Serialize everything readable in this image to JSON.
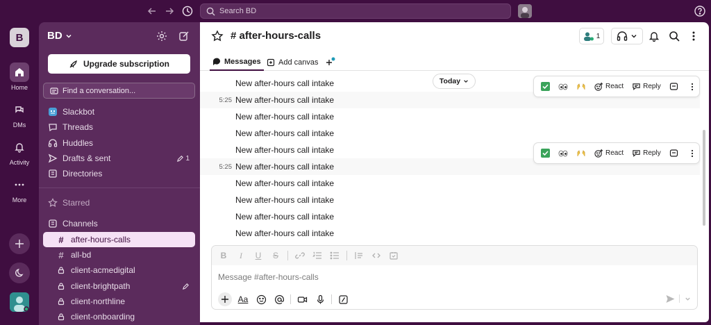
{
  "topbar": {
    "search_placeholder": "Search BD",
    "icons": [
      "back-arrow-icon",
      "forward-arrow-icon",
      "history-icon",
      "help-icon"
    ]
  },
  "rail": {
    "workspace_initial": "B",
    "items": [
      {
        "label": "Home",
        "icon": "home-icon",
        "active": true
      },
      {
        "label": "DMs",
        "icon": "dms-icon",
        "active": false
      },
      {
        "label": "Activity",
        "icon": "bell-icon",
        "active": false
      },
      {
        "label": "More",
        "icon": "more-icon",
        "active": false
      }
    ]
  },
  "sidebar": {
    "workspace_name": "BD",
    "upgrade_label": "Upgrade subscription",
    "find_placeholder": "Find a conversation...",
    "nav": [
      {
        "label": "Slackbot",
        "icon": "slackbot-icon"
      },
      {
        "label": "Threads",
        "icon": "threads-icon"
      },
      {
        "label": "Huddles",
        "icon": "headphones-icon"
      },
      {
        "label": "Drafts & sent",
        "icon": "send-icon",
        "count": "1"
      },
      {
        "label": "Directories",
        "icon": "directory-icon"
      }
    ],
    "starred_label": "Starred",
    "channels_label": "Channels",
    "channels": [
      {
        "name": "after-hours-calls",
        "private": false,
        "active": true
      },
      {
        "name": "all-bd",
        "private": false,
        "active": false
      },
      {
        "name": "client-acmedigital",
        "private": true,
        "active": false
      },
      {
        "name": "client-brightpath",
        "private": true,
        "active": false
      },
      {
        "name": "client-northline",
        "private": true,
        "active": false
      },
      {
        "name": "client-onboarding",
        "private": true,
        "active": false
      }
    ]
  },
  "channel": {
    "title": "# after-hours-calls",
    "member_count": "1",
    "tabs": [
      {
        "label": "Messages",
        "active": true
      },
      {
        "label": "Add canvas",
        "active": false
      }
    ]
  },
  "messages": {
    "date_pill": "Today",
    "rows": [
      {
        "time": "",
        "text": "New after-hours call intake",
        "highlight": false
      },
      {
        "time": "5:25",
        "text": "New after-hours call intake",
        "highlight": true
      },
      {
        "time": "",
        "text": "New after-hours call intake",
        "highlight": false
      },
      {
        "time": "",
        "text": "New after-hours call intake",
        "highlight": false
      },
      {
        "time": "",
        "text": "New after-hours call intake",
        "highlight": false
      },
      {
        "time": "5:25",
        "text": "New after-hours call intake",
        "highlight": true
      },
      {
        "time": "",
        "text": "New after-hours call intake",
        "highlight": false
      },
      {
        "time": "",
        "text": "New after-hours call intake",
        "highlight": false
      },
      {
        "time": "",
        "text": "New after-hours call intake",
        "highlight": false
      },
      {
        "time": "",
        "text": "New after-hours call intake",
        "highlight": false
      }
    ],
    "actions": {
      "react_label": "React",
      "reply_label": "Reply"
    }
  },
  "composer": {
    "placeholder": "Message #after-hours-calls",
    "format_label": "Aa"
  },
  "colors": {
    "aubergine": "#3f0e40",
    "sidebar": "#5b2b5c",
    "active_channel": "#f5e1f5",
    "presence": "#2bac76"
  }
}
